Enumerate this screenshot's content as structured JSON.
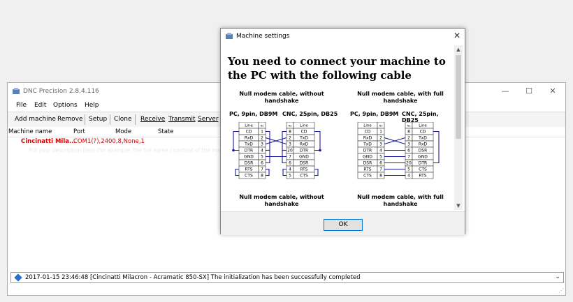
{
  "main_window": {
    "title": "DNC Precision 2.8.4.116",
    "menu": [
      "File",
      "Edit",
      "Options",
      "Help"
    ],
    "toolbar": [
      "Add machine",
      "Remove",
      "Setup",
      "Clone",
      "Receive",
      "Transmit",
      "Server"
    ],
    "columns": [
      "Machine name",
      "Port",
      "Mode",
      "State"
    ],
    "machine": {
      "name": "Cincinatti Mila...",
      "port": "COM1(?),2400,8,None,1",
      "description": "Put your description here (for example, the full name / content of the machine)"
    },
    "status_message": "2017-01-15 23:46:48 [Cincinatti Milacron - Acramatic 850-SX] The initialization has been successfully completed"
  },
  "dialog": {
    "title": "Machine settings",
    "headline_1": "You need to connect your machine to",
    "headline_2": "the PC with the following cable",
    "diagrams": [
      {
        "caption": "Null modem cable, without handshake",
        "left_label": "PC, 9pin, DB9M",
        "right_label": "CNC, 25pin, DB25",
        "left_pins": [
          "1",
          "2",
          "3",
          "4",
          "5",
          "6",
          "7",
          "8"
        ],
        "right_pins": [
          "8",
          "2",
          "3",
          "20",
          "7",
          "6",
          "4",
          "5"
        ]
      },
      {
        "caption": "Null modem cable, with full handshake",
        "left_label": "PC, 9pin, DB9M",
        "right_label": "CNC, 25pin, DB25",
        "left_pins": [
          "1",
          "2",
          "3",
          "4",
          "5",
          "6",
          "7",
          "8"
        ],
        "right_pins": [
          "8",
          "2",
          "3",
          "6",
          "7",
          "20",
          "5",
          "4"
        ]
      }
    ],
    "lines": [
      "CD",
      "RxD",
      "TxD",
      "DTR",
      "GND",
      "DSR",
      "RTS",
      "CTS"
    ],
    "right_lines_nohs": [
      "CD",
      "TxD",
      "RxD",
      "DTR",
      "GND",
      "DSR",
      "RTS",
      "CTS"
    ],
    "right_lines_fullhs": [
      "CD",
      "TxD",
      "RxD",
      "DSR",
      "GND",
      "DTR",
      "CTS",
      "RTS"
    ],
    "line_header": "Line",
    "pin_header": "No",
    "caption_bottom_left": "Null modem cable, without handshake",
    "caption_bottom_right": "Null modem cable, with full handshake",
    "ok_label": "OK",
    "colors": {
      "wire": "#1a1aa0",
      "dot": "#1a1aa0"
    }
  }
}
